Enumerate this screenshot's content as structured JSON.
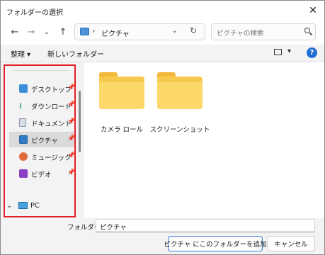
{
  "window": {
    "title": "フォルダーの選択"
  },
  "nav": {
    "back_icon": "arrow-left-icon",
    "forward_icon": "arrow-right-icon",
    "recent_icon": "chevron-down-icon",
    "up_icon": "arrow-up-icon",
    "address": {
      "separator": "›",
      "location": "ピクチャ"
    },
    "search_placeholder": "ピクチャの検索"
  },
  "commands": {
    "organize": "整理 ▾",
    "new_folder": "新しいフォルダー",
    "help": "?"
  },
  "sidebar": {
    "items": [
      {
        "label": "デスクトップ",
        "icon": "desktop-icon",
        "pinned": true
      },
      {
        "label": "ダウンロード",
        "icon": "download-icon",
        "pinned": true
      },
      {
        "label": "ドキュメント",
        "icon": "document-icon",
        "pinned": true
      },
      {
        "label": "ピクチャ",
        "icon": "pictures-icon",
        "pinned": true,
        "selected": true
      },
      {
        "label": "ミュージック",
        "icon": "music-icon",
        "pinned": true
      },
      {
        "label": "ビデオ",
        "icon": "video-icon",
        "pinned": true
      }
    ],
    "pc_label": "PC"
  },
  "content": {
    "folders": [
      {
        "name": "カメラ ロール"
      },
      {
        "name": "スクリーンショット"
      }
    ]
  },
  "footer": {
    "folder_label": "フォルダー:",
    "folder_value": "ピクチャ",
    "add_button": "ピクチャ にこのフォルダーを追加",
    "cancel_button": "キャンセル"
  },
  "colors": {
    "highlight_box": "#e41d26",
    "accent": "#1f6fd1",
    "folder": "#f8c94f"
  }
}
